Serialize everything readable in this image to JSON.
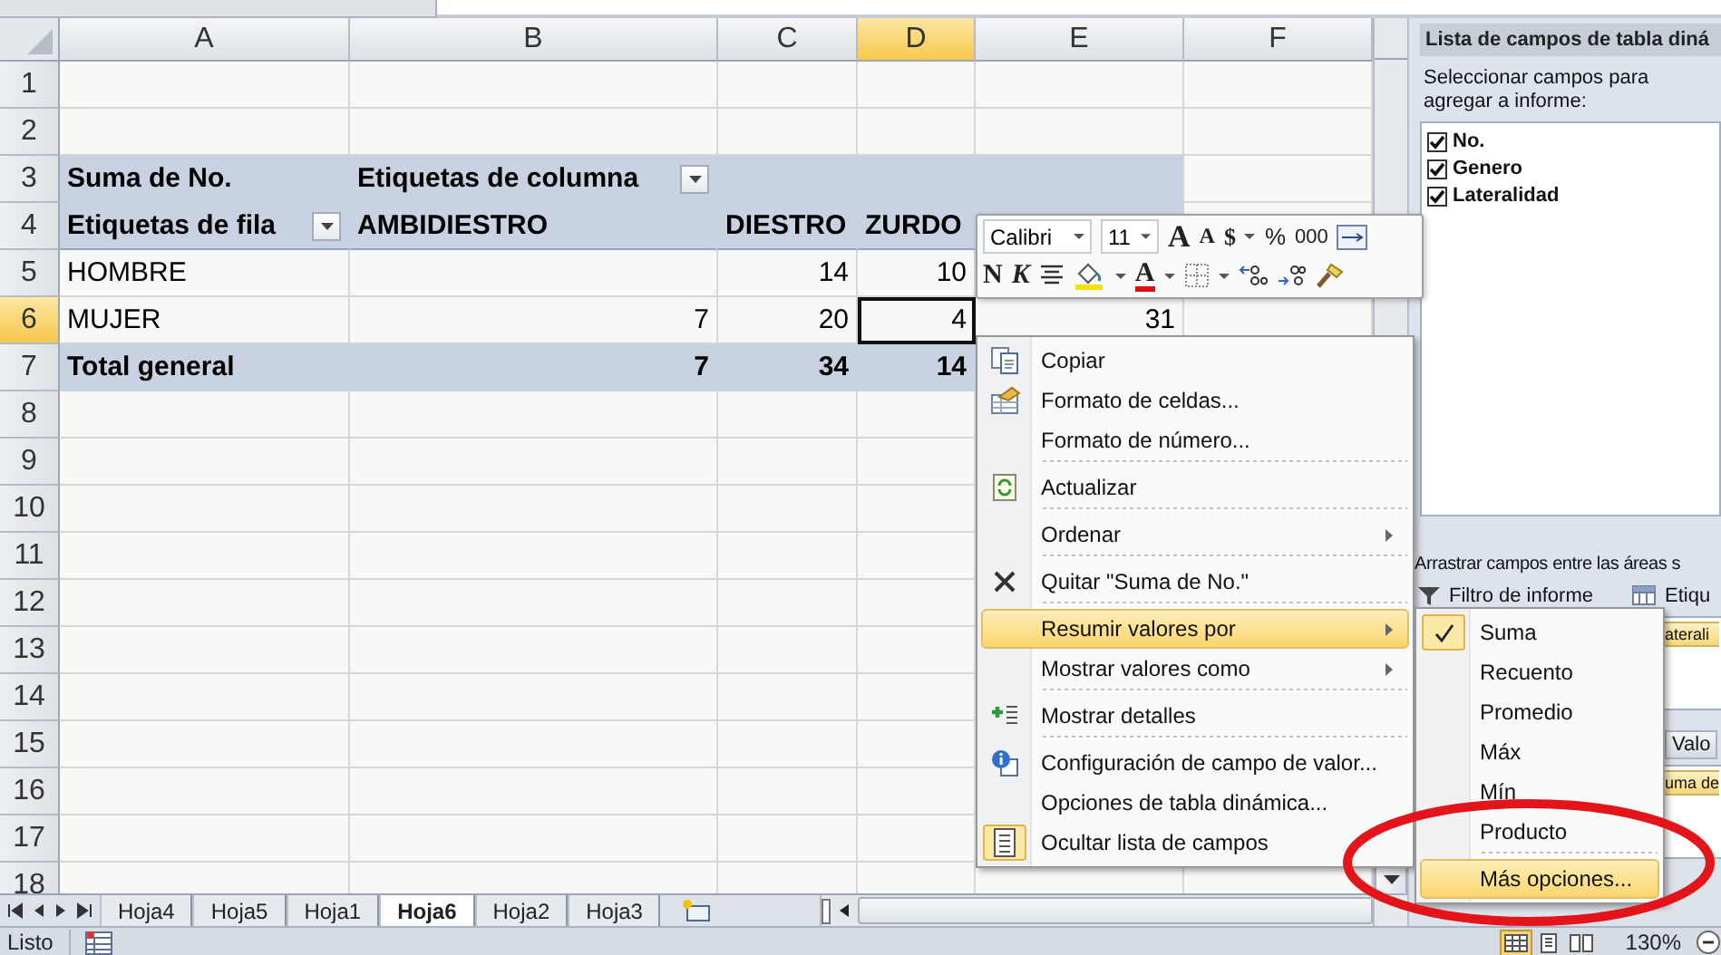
{
  "sheet": {
    "columns": [
      {
        "label": "A",
        "selected": false
      },
      {
        "label": "B",
        "selected": false
      },
      {
        "label": "C",
        "selected": false
      },
      {
        "label": "D",
        "selected": true
      },
      {
        "label": "E",
        "selected": false
      },
      {
        "label": "F",
        "selected": false
      }
    ],
    "rows": [
      {
        "label": "1",
        "selected": false
      },
      {
        "label": "2",
        "selected": false
      },
      {
        "label": "3",
        "selected": false
      },
      {
        "label": "4",
        "selected": false
      },
      {
        "label": "5",
        "selected": false
      },
      {
        "label": "6",
        "selected": true
      },
      {
        "label": "7",
        "selected": false
      },
      {
        "label": "8",
        "selected": false
      },
      {
        "label": "9",
        "selected": false
      },
      {
        "label": "10",
        "selected": false
      },
      {
        "label": "11",
        "selected": false
      },
      {
        "label": "12",
        "selected": false
      },
      {
        "label": "13",
        "selected": false
      },
      {
        "label": "14",
        "selected": false
      },
      {
        "label": "15",
        "selected": false
      },
      {
        "label": "16",
        "selected": false
      },
      {
        "label": "17",
        "selected": false
      },
      {
        "label": "18",
        "selected": false
      }
    ]
  },
  "pivot": {
    "value_field": "Suma de No.",
    "column_labels": "Etiquetas de columna",
    "row_labels": "Etiquetas de fila",
    "columns": [
      "AMBIDIESTRO",
      "DIESTRO",
      "ZURDO"
    ],
    "rows": [
      {
        "label": "HOMBRE",
        "values": [
          "14",
          "10"
        ]
      },
      {
        "label": "MUJER",
        "values": [
          "7",
          "20",
          "4"
        ],
        "total": "31"
      }
    ],
    "total": {
      "label": "Total general",
      "values": [
        "7",
        "34",
        "14"
      ]
    }
  },
  "mini_toolbar": {
    "font": "Calibri",
    "size": "11",
    "grow": "A",
    "shrink": "A",
    "currency": "$",
    "percent": "%",
    "thousands": "000",
    "bold": "N",
    "italic": "K",
    "font_color": "A"
  },
  "context_menu": {
    "items": [
      {
        "label": "Copiar",
        "submenu": false,
        "selected": false,
        "checked": false,
        "separator_after": false
      },
      {
        "label": "Formato de celdas...",
        "submenu": false,
        "selected": false,
        "checked": false,
        "separator_after": false
      },
      {
        "label": "Formato de número...",
        "submenu": false,
        "selected": false,
        "checked": false,
        "separator_after": true
      },
      {
        "label": "Actualizar",
        "submenu": false,
        "selected": false,
        "checked": false,
        "separator_after": true
      },
      {
        "label": "Ordenar",
        "submenu": true,
        "selected": false,
        "checked": false,
        "separator_after": true
      },
      {
        "label": "Quitar \"Suma de No.\"",
        "submenu": false,
        "selected": false,
        "checked": false,
        "separator_after": true
      },
      {
        "label": "Resumir valores por",
        "submenu": true,
        "selected": true,
        "checked": false,
        "separator_after": false
      },
      {
        "label": "Mostrar valores como",
        "submenu": true,
        "selected": false,
        "checked": false,
        "separator_after": true
      },
      {
        "label": "Mostrar detalles",
        "submenu": false,
        "selected": false,
        "checked": false,
        "separator_after": true
      },
      {
        "label": "Configuración de campo de valor...",
        "submenu": false,
        "selected": false,
        "checked": false,
        "separator_after": false
      },
      {
        "label": "Opciones de tabla dinámica...",
        "submenu": false,
        "selected": false,
        "checked": false,
        "separator_after": false
      },
      {
        "label": "Ocultar lista de campos",
        "submenu": false,
        "selected": false,
        "checked": true,
        "separator_after": false
      }
    ]
  },
  "submenu": {
    "items": [
      {
        "label": "Suma",
        "checked": true,
        "selected": false,
        "separator_after": false
      },
      {
        "label": "Recuento",
        "checked": false,
        "selected": false,
        "separator_after": false
      },
      {
        "label": "Promedio",
        "checked": false,
        "selected": false,
        "separator_after": false
      },
      {
        "label": "Máx",
        "checked": false,
        "selected": false,
        "separator_after": false
      },
      {
        "label": "Mín",
        "checked": false,
        "selected": false,
        "separator_after": false
      },
      {
        "label": "Producto",
        "checked": false,
        "selected": false,
        "separator_after": true
      },
      {
        "label": "Más opciones...",
        "checked": false,
        "selected": true,
        "separator_after": false
      }
    ]
  },
  "field_list": {
    "title": "Lista de campos de tabla diná",
    "instruction": "Seleccionar campos para agregar a informe:",
    "fields": [
      {
        "label": "No.",
        "checked": true
      },
      {
        "label": "Genero",
        "checked": true
      },
      {
        "label": "Lateralidad",
        "checked": true
      }
    ],
    "drag_hint": "Arrastrar campos entre las áreas s",
    "areas": [
      {
        "kind": "filter",
        "label": "Filtro de informe"
      },
      {
        "kind": "columns",
        "label": "Etiqu",
        "chips": [
          "aterali"
        ]
      },
      {
        "kind": "values",
        "label": "Valo",
        "chips": [
          "uma de"
        ]
      }
    ]
  },
  "sheet_tabs": [
    {
      "label": "Hoja4",
      "selected": false
    },
    {
      "label": "Hoja5",
      "selected": false
    },
    {
      "label": "Hoja1",
      "selected": false
    },
    {
      "label": "Hoja6",
      "selected": true
    },
    {
      "label": "Hoja2",
      "selected": false
    },
    {
      "label": "Hoja3",
      "selected": false
    }
  ],
  "status_bar": {
    "text": "Listo",
    "zoom": "130%"
  }
}
